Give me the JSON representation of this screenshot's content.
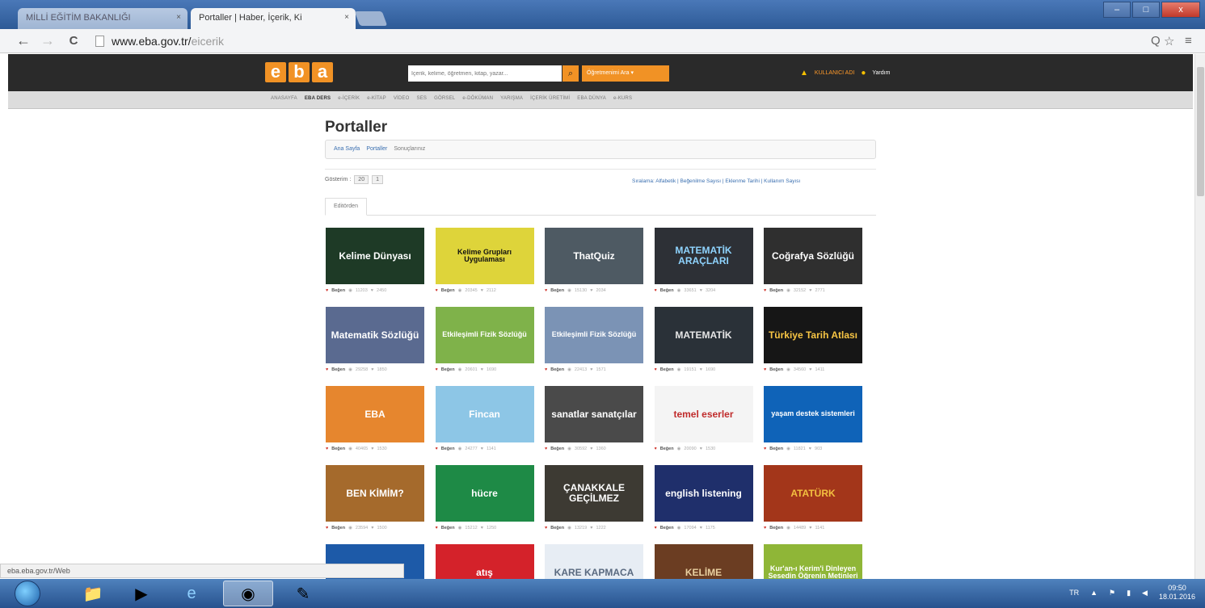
{
  "browser": {
    "tabs": [
      {
        "label": "MİLLİ EĞİTİM BAKANLIĞI",
        "close": "×"
      },
      {
        "label": "Portaller | Haber, İçerik, Ki",
        "close": "×"
      }
    ],
    "nav": {
      "back": "←",
      "forward": "→",
      "reload": "C"
    },
    "url_host": "www.eba.gov.tr/",
    "url_path": "eicerik",
    "zoom_icon": "Q",
    "star": "☆",
    "menu": "≡",
    "window": {
      "min": "–",
      "max": "□",
      "close": "x"
    }
  },
  "eba": {
    "logo": [
      "e",
      "b",
      "a"
    ],
    "search_placeholder": "İçerik, kelime, öğretmen, kitap, yazar...",
    "search_icon": "⌕",
    "teacher_button": "Öğretmenimi Ara ▾",
    "user_name": "KULLANICI ADI",
    "help": "Yardım",
    "menu": [
      "ANASAYFA",
      "EBA DERS",
      "e-İÇERİK",
      "e-KİTAP",
      "VİDEO",
      "SES",
      "GÖRSEL",
      "e-DÖKÜMAN",
      "YARIŞMA",
      "İÇERİK ÜRETİMİ",
      "EBA DÜNYA",
      "e-KURS"
    ]
  },
  "page": {
    "title": "Portaller",
    "breadcrumbs": [
      "Ana Sayfa",
      "Portaller",
      "Sonuçlarınız"
    ],
    "show_label": "Gösterim :",
    "per_page": "20",
    "page_no": "1",
    "sort": "Sıralama: Alfabetik | Beğenilme Sayısı | Eklenme Tarihi | Kullanım Sayısı",
    "tab": "Editörden"
  },
  "cards": [
    {
      "title": "Kelime Dünyası",
      "like": "Beğen",
      "views": "11203",
      "likes": "2450",
      "bg": "#1e3a26",
      "fg": "#ffffff"
    },
    {
      "title": "Kelime Grupları Uygulaması",
      "like": "Beğen",
      "views": "20345",
      "likes": "2112",
      "bg": "#ded43a",
      "fg": "#111111"
    },
    {
      "title": "ThatQuiz",
      "like": "Beğen",
      "views": "15130",
      "likes": "2034",
      "bg": "#4e5a63",
      "fg": "#ffffff"
    },
    {
      "title": "MATEMATİK ARAÇLARI",
      "like": "Beğen",
      "views": "33651",
      "likes": "3204",
      "bg": "#2d3036",
      "fg": "#8fd4ff"
    },
    {
      "title": "Coğrafya Sözlüğü",
      "like": "Beğen",
      "views": "32152",
      "likes": "2771",
      "bg": "#2f2f2f",
      "fg": "#ffffff"
    },
    {
      "title": "Matematik Sözlüğü",
      "like": "Beğen",
      "views": "29258",
      "likes": "1850",
      "bg": "#5a6a90",
      "fg": "#ffffff"
    },
    {
      "title": "Etkileşimli Fizik Sözlüğü",
      "like": "Beğen",
      "views": "20601",
      "likes": "1690",
      "bg": "#7fb24a",
      "fg": "#ffffff"
    },
    {
      "title": "Etkileşimli Fizik Sözlüğü",
      "like": "Beğen",
      "views": "22413",
      "likes": "1571",
      "bg": "#7b93b5",
      "fg": "#ffffff"
    },
    {
      "title": "MATEMATİK",
      "like": "Beğen",
      "views": "19151",
      "likes": "1690",
      "bg": "#2a3138",
      "fg": "#e6e6e6"
    },
    {
      "title": "Türkiye Tarih Atlası",
      "like": "Beğen",
      "views": "34560",
      "likes": "1411",
      "bg": "#161616",
      "fg": "#f7c544"
    },
    {
      "title": "EBA",
      "like": "Beğen",
      "views": "40465",
      "likes": "1530",
      "bg": "#e6862e",
      "fg": "#ffffff"
    },
    {
      "title": "Fincan",
      "like": "Beğen",
      "views": "24277",
      "likes": "1141",
      "bg": "#8dc6e6",
      "fg": "#ffffff"
    },
    {
      "title": "sanatlar sanatçılar",
      "like": "Beğen",
      "views": "30592",
      "likes": "1360",
      "bg": "#4a4a4a",
      "fg": "#ffffff"
    },
    {
      "title": "temel eserler",
      "like": "Beğen",
      "views": "20090",
      "likes": "1530",
      "bg": "#f4f4f4",
      "fg": "#c02c2c"
    },
    {
      "title": "yaşam destek sistemleri",
      "like": "Beğen",
      "views": "11821",
      "likes": "903",
      "bg": "#0f63b8",
      "fg": "#ffffff"
    },
    {
      "title": "BEN KİMİM?",
      "like": "Beğen",
      "views": "23594",
      "likes": "1500",
      "bg": "#a56a2c",
      "fg": "#ffffff"
    },
    {
      "title": "hücre",
      "like": "Beğen",
      "views": "15212",
      "likes": "1250",
      "bg": "#1e8a46",
      "fg": "#ffffff"
    },
    {
      "title": "ÇANAKKALE GEÇİLMEZ",
      "like": "Beğen",
      "views": "13219",
      "likes": "1222",
      "bg": "#3d3a33",
      "fg": "#ffffff"
    },
    {
      "title": "english listening",
      "like": "Beğen",
      "views": "17094",
      "likes": "1175",
      "bg": "#1f2f6b",
      "fg": "#ffffff"
    },
    {
      "title": "ATATÜRK",
      "like": "Beğen",
      "views": "14489",
      "likes": "1141",
      "bg": "#a3361a",
      "fg": "#f3c040"
    },
    {
      "title": "",
      "like": "",
      "views": "",
      "likes": "",
      "bg": "#1d5aa8",
      "fg": "#ffffff"
    },
    {
      "title": "atış",
      "like": "",
      "views": "",
      "likes": "",
      "bg": "#d4222a",
      "fg": "#ffffff"
    },
    {
      "title": "KARE KAPMACA",
      "like": "",
      "views": "",
      "likes": "",
      "bg": "#e7edf4",
      "fg": "#5a6a80"
    },
    {
      "title": "KELİME",
      "like": "",
      "views": "",
      "likes": "",
      "bg": "#6b3d22",
      "fg": "#e9d0a0"
    },
    {
      "title": "Kur'an-ı Kerim'i Dinleyen Sesedin Öğrenin Metinleri",
      "like": "",
      "views": "",
      "likes": "",
      "bg": "#8fb637",
      "fg": "#ffffff"
    }
  ],
  "status_url": "eba.eba.gov.tr/Web",
  "taskbar": {
    "lang": "TR",
    "time": "09:50",
    "date": "18.01.2016"
  }
}
